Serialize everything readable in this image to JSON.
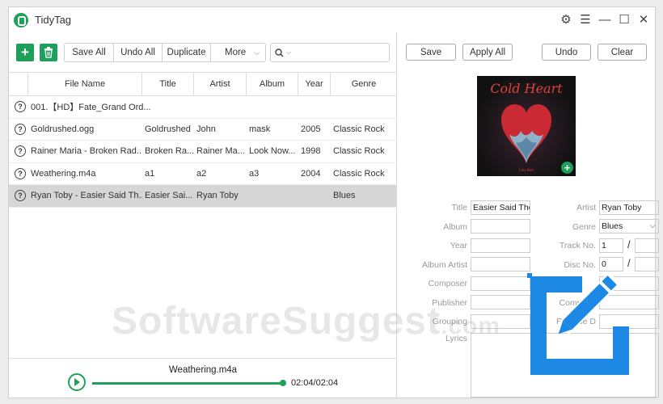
{
  "app": {
    "title": "TidyTag"
  },
  "toolbar": {
    "save_all": "Save All",
    "undo_all": "Undo All",
    "duplicate": "Duplicate",
    "more": "More"
  },
  "table": {
    "headers": [
      "File Name",
      "Title",
      "Artist",
      "Album",
      "Year",
      "Genre"
    ],
    "rows": [
      {
        "file": "001.【HD】Fate_Grand Ord...",
        "title": "",
        "artist": "",
        "album": "",
        "year": "",
        "genre": ""
      },
      {
        "file": "Goldrushed.ogg",
        "title": "Goldrushed",
        "artist": "John",
        "album": "mask",
        "year": "2005",
        "genre": "Classic Rock"
      },
      {
        "file": "Rainer Maria - Broken Rad...",
        "title": "Broken Ra...",
        "artist": "Rainer Ma...",
        "album": "Look Now...",
        "year": "1998",
        "genre": "Classic Rock"
      },
      {
        "file": "Weathering.m4a",
        "title": "a1",
        "artist": "a2",
        "album": "a3",
        "year": "2004",
        "genre": "Classic Rock"
      },
      {
        "file": "Ryan Toby - Easier Said Th...",
        "title": "Easier Sai...",
        "artist": "Ryan Toby",
        "album": "",
        "year": "",
        "genre": "Blues"
      }
    ]
  },
  "player": {
    "track": "Weathering.m4a",
    "time": "02:04/02:04",
    "progress": 1.0
  },
  "editor": {
    "save": "Save",
    "apply_all": "Apply All",
    "undo": "Undo",
    "clear": "Clear",
    "cover_title": "Cold Heart",
    "cover_sub": "Lou Ann",
    "labels": {
      "title": "Title",
      "artist": "Artist",
      "album": "Album",
      "genre": "Genre",
      "year": "Year",
      "track_no": "Track No.",
      "album_artist": "Album Artist",
      "disc_no": "Disc No.",
      "composer": "Composer",
      "publisher": "Publisher",
      "comment": "Comment",
      "grouping": "Grouping",
      "release": "Release D",
      "lyrics": "Lyrics"
    },
    "values": {
      "title": "Easier Said Then",
      "artist": "Ryan Toby",
      "genre": "Blues",
      "track_no": "1",
      "track_total": "",
      "disc_no": "0",
      "disc_total": ""
    }
  },
  "watermark": {
    "main": "SoftwareSuggest",
    "tld": ".com"
  },
  "colors": {
    "accent": "#1fa05a",
    "badge": "#1e88e5"
  }
}
